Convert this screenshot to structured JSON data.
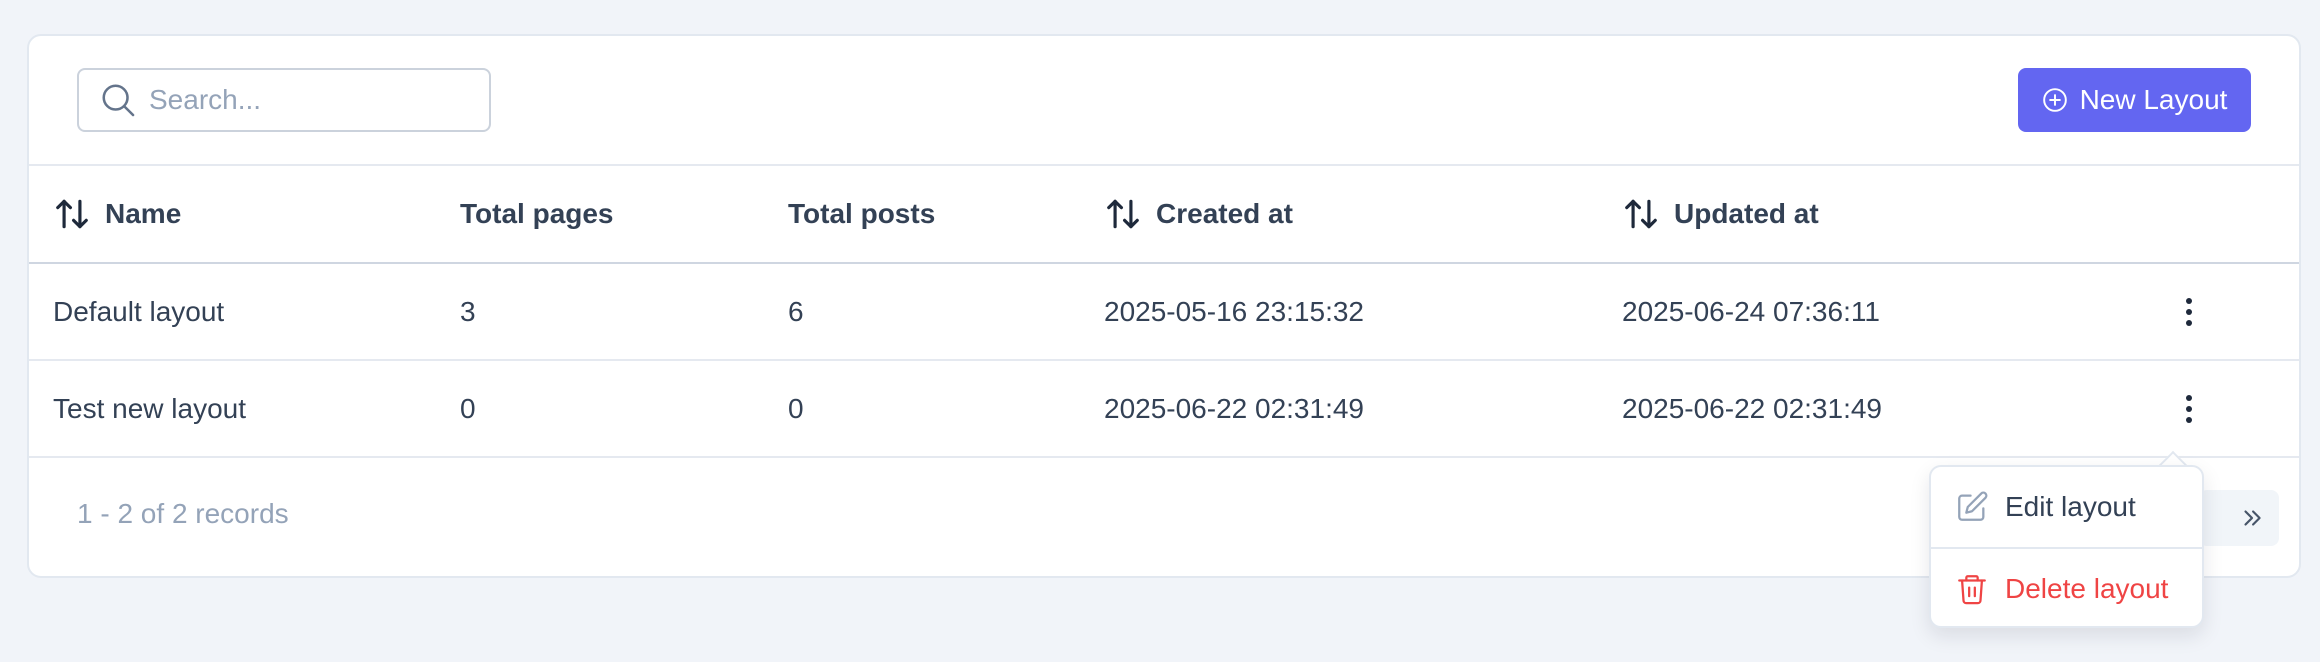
{
  "search": {
    "placeholder": "Search...",
    "value": ""
  },
  "toolbar": {
    "new_label": "New Layout"
  },
  "table": {
    "columns": {
      "name": "Name",
      "pages": "Total pages",
      "posts": "Total posts",
      "created": "Created at",
      "updated": "Updated at"
    },
    "rows": [
      {
        "name": "Default layout",
        "pages": "3",
        "posts": "6",
        "created": "2025-05-16 23:15:32",
        "updated": "2025-06-24 07:36:11"
      },
      {
        "name": "Test new layout",
        "pages": "0",
        "posts": "0",
        "created": "2025-06-22 02:31:49",
        "updated": "2025-06-22 02:31:49"
      }
    ]
  },
  "footer": {
    "records": "1 - 2 of 2 records"
  },
  "menu": {
    "edit": "Edit layout",
    "delete": "Delete layout"
  },
  "colors": {
    "accent": "#6366f1",
    "danger": "#ef4444",
    "background": "#f1f4f9"
  },
  "icons": {
    "search": "search-icon",
    "new": "plus-circle-icon",
    "sort": "sort-arrows-icon",
    "more": "more-vertical-icon",
    "edit": "edit-icon",
    "delete": "trash-icon",
    "next": "chevrons-right-icon"
  }
}
